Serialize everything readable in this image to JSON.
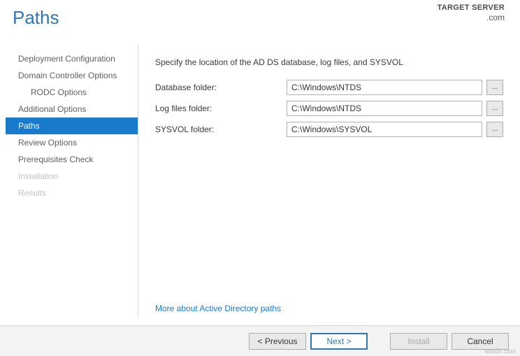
{
  "header": {
    "title": "Paths",
    "target_label": "TARGET SERVER",
    "target_value": ".com"
  },
  "sidebar": {
    "items": [
      {
        "label": "Deployment Configuration",
        "indent": false,
        "selected": false,
        "disabled": false
      },
      {
        "label": "Domain Controller Options",
        "indent": false,
        "selected": false,
        "disabled": false
      },
      {
        "label": "RODC Options",
        "indent": true,
        "selected": false,
        "disabled": false
      },
      {
        "label": "Additional Options",
        "indent": false,
        "selected": false,
        "disabled": false
      },
      {
        "label": "Paths",
        "indent": false,
        "selected": true,
        "disabled": false
      },
      {
        "label": "Review Options",
        "indent": false,
        "selected": false,
        "disabled": false
      },
      {
        "label": "Prerequisites Check",
        "indent": false,
        "selected": false,
        "disabled": false
      },
      {
        "label": "Installation",
        "indent": false,
        "selected": false,
        "disabled": true
      },
      {
        "label": "Results",
        "indent": false,
        "selected": false,
        "disabled": true
      }
    ]
  },
  "main": {
    "instruction": "Specify the location of the AD DS database, log files, and SYSVOL",
    "rows": [
      {
        "label": "Database folder:",
        "value": "C:\\Windows\\NTDS"
      },
      {
        "label": "Log files folder:",
        "value": "C:\\Windows\\NTDS"
      },
      {
        "label": "SYSVOL folder:",
        "value": "C:\\Windows\\SYSVOL"
      }
    ],
    "browse_label": "...",
    "more_link": "More about Active Directory paths"
  },
  "footer": {
    "previous": "< Previous",
    "next": "Next >",
    "install": "Install",
    "cancel": "Cancel"
  },
  "watermark": "wsxdn.com"
}
